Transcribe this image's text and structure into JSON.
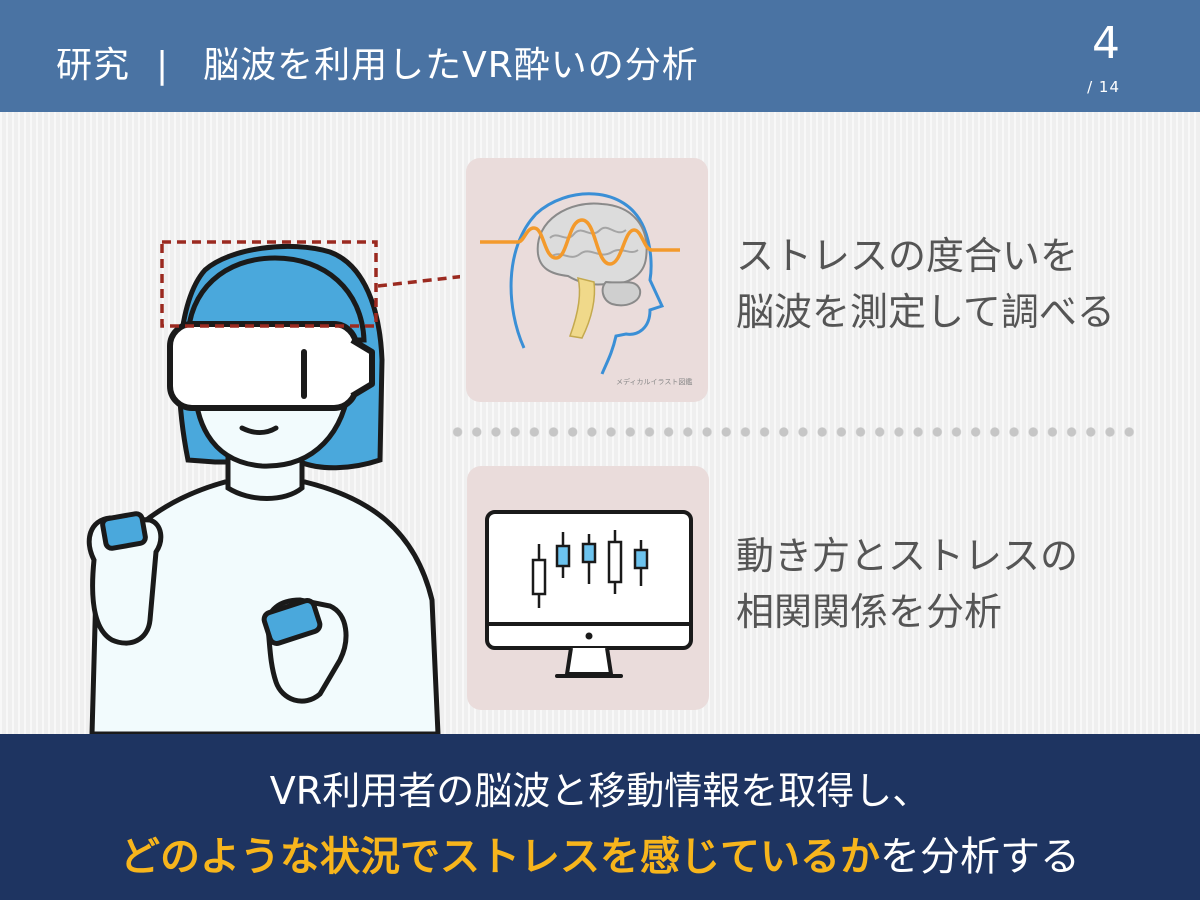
{
  "header": {
    "category": "研究",
    "separator": "|",
    "title": "脳波を利用したVR酔いの分析",
    "page": "4",
    "total": "/ 14"
  },
  "panels": [
    {
      "caption_line1": "ストレスの度合いを",
      "caption_line2": "脳波を測定して調べる",
      "icon": "brain-wave-icon"
    },
    {
      "caption_line1": "動き方とストレスの",
      "caption_line2": "相関関係を分析",
      "icon": "monitor-chart-icon"
    }
  ],
  "brain_credit": "メディカルイラスト図鑑",
  "footer": {
    "line1": "VR利用者の脳波と移動情報を取得し、",
    "line2_highlight": "どのような状況でストレスを感じているか",
    "line2_rest": "を分析する"
  },
  "colors": {
    "header_bg": "#4a73a3",
    "footer_bg": "#1e3461",
    "highlight": "#f7b51c",
    "accent_blue": "#4aa8dc",
    "wave_orange": "#f39a2c",
    "dashed_red": "#9b2a20"
  }
}
